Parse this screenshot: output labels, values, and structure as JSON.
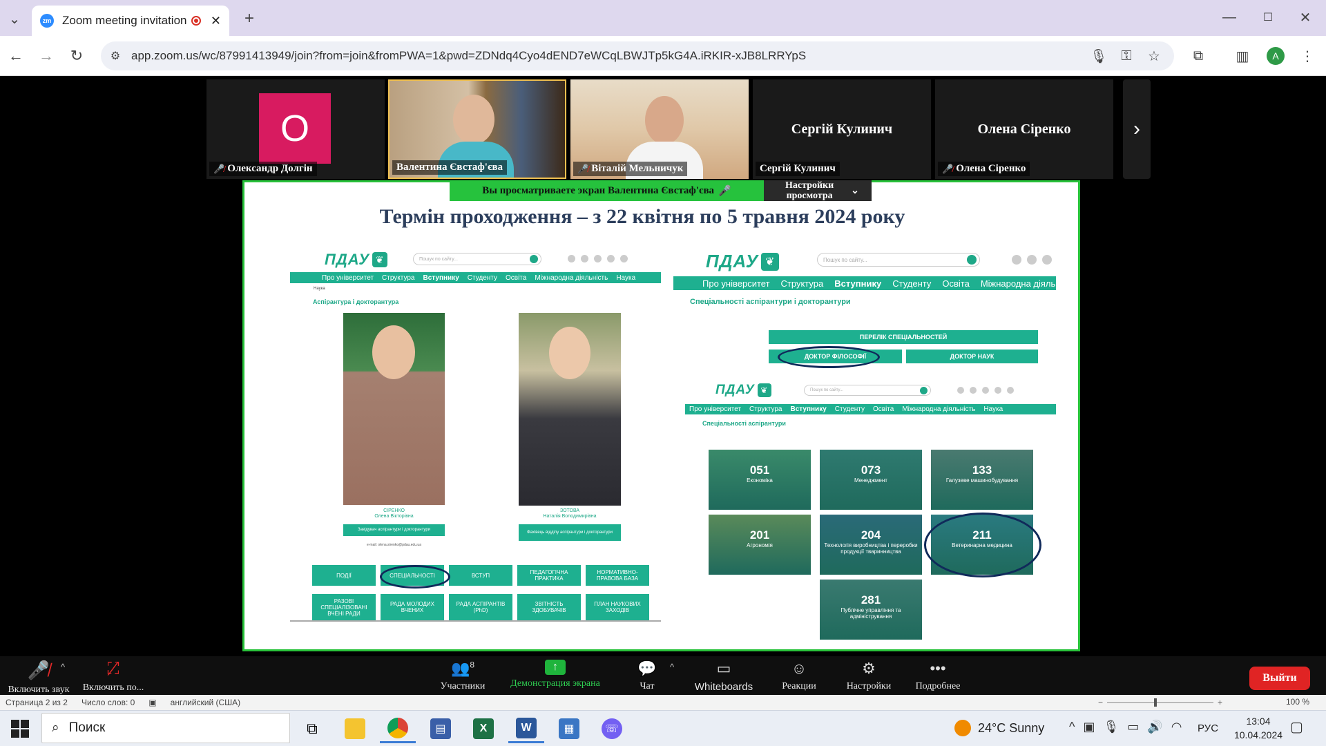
{
  "browser": {
    "tab_title": "Zoom meeting invitation - Z",
    "new_tab": "+",
    "url": "app.zoom.us/wc/87991413949/join?from=join&fromPWA=1&pwd=ZDNdq4Cyo4dEND7eWCqLBWJTp5kG4A.iRKIR-xJB8LRRYpS",
    "profile_initial": "A"
  },
  "participants": [
    {
      "name": "Олександр Долгін",
      "initial": "О",
      "muted": true
    },
    {
      "name": "Валентина Євстаф'єва",
      "muted": false
    },
    {
      "name": "Віталій Мельничук",
      "muted": true
    },
    {
      "name": "Сергій Кулинич",
      "muted": false
    },
    {
      "name": "Олена Сіренко",
      "muted": true
    }
  ],
  "share": {
    "banner": "Вы просматриваете экран  Валентина Євстаф'єва",
    "view_options": "Настройки просмотра"
  },
  "slide": {
    "title": "Термін проходження – з 22 квітня по 5 травня 2024 року",
    "left": {
      "logo": "ПДАУ",
      "search_placeholder": "Пошук по сайту...",
      "nav": [
        "Про університет",
        "Структура",
        "Вступнику",
        "Студенту",
        "Освіта",
        "Міжнародна діяльність",
        "Наука"
      ],
      "crumb": "Наука",
      "heading": "Аспірантура і докторантура",
      "persons": [
        {
          "surname": "СІРЕНКО",
          "name": "Олена Вікторівна",
          "role": "Завідувач аспірантури і докторантури",
          "email": "e-mail: olena.sirenko@pdau.edu.ua"
        },
        {
          "surname": "ЗОТОВА",
          "name": "Наталія Володимирівна",
          "role": "Фахівець відділу аспірантури і докторантури"
        }
      ],
      "buttons": [
        "ПОДІЇ",
        "СПЕЦІАЛЬНОСТІ",
        "ВСТУП",
        "ПЕДАГОГІЧНА ПРАКТИКА",
        "НОРМАТИВНО-ПРАВОВА БАЗА",
        "РАЗОВІ СПЕЦІАЛІЗОВАНІ ВЧЕНІ РАДИ",
        "РАДА МОЛОДИХ ВЧЕНИХ",
        "РАДА АСПІРАНТІВ (PhD)",
        "ЗВІТНІСТЬ ЗДОБУВАЧІВ",
        "ПЛАН НАУКОВИХ ЗАХОДІВ"
      ]
    },
    "right": {
      "logo": "ПДАУ",
      "search_placeholder": "Пошук по сайту...",
      "nav": [
        "Про університет",
        "Структура",
        "Вступнику",
        "Студенту",
        "Освіта",
        "Міжнародна діяльні"
      ],
      "heading": "Спеціальності аспірантури і докторантури",
      "btn_list": "ПЕРЕЛІК СПЕЦІАЛЬНОСТЕЙ",
      "btn_phd": "ДОКТОР ФІЛОСОФІЇ",
      "btn_dsc": "ДОКТОР НАУК",
      "sub_logo": "ПДАУ",
      "sub_search": "Пошук по сайту...",
      "sub_nav": [
        "Про університет",
        "Структура",
        "Вступнику",
        "Студенту",
        "Освіта",
        "Міжнародна діяльність",
        "Наука"
      ],
      "sub_heading": "Спеціальності аспірантури",
      "specialties": [
        {
          "code": "051",
          "name": "Економіка"
        },
        {
          "code": "073",
          "name": "Менеджмент"
        },
        {
          "code": "133",
          "name": "Галузеве машинобудування"
        },
        {
          "code": "201",
          "name": "Агрономія"
        },
        {
          "code": "204",
          "name": "Технологія виробництва і переробки продукції тваринництва"
        },
        {
          "code": "211",
          "name": "Ветеринарна медицина"
        },
        {
          "code": "281",
          "name": "Публічне управління та адміністрування"
        }
      ]
    }
  },
  "toolbar": {
    "audio": "Включить звук",
    "video": "Включить по...",
    "participants": "Участники",
    "participants_count": "8",
    "share": "Демонстрация экрана",
    "chat": "Чат",
    "whiteboards": "Whiteboards",
    "reactions": "Реакции",
    "settings": "Настройки",
    "more": "Подробнее",
    "leave": "Выйти"
  },
  "word": {
    "page": "Страница 2 из 2",
    "words": "Число слов: 0",
    "lang": "английский (США)",
    "zoom": "100 %"
  },
  "taskbar": {
    "search": "Поиск",
    "weather": "24°C  Sunny",
    "lang": "РУС",
    "time": "13:04",
    "date": "10.04.2024"
  }
}
